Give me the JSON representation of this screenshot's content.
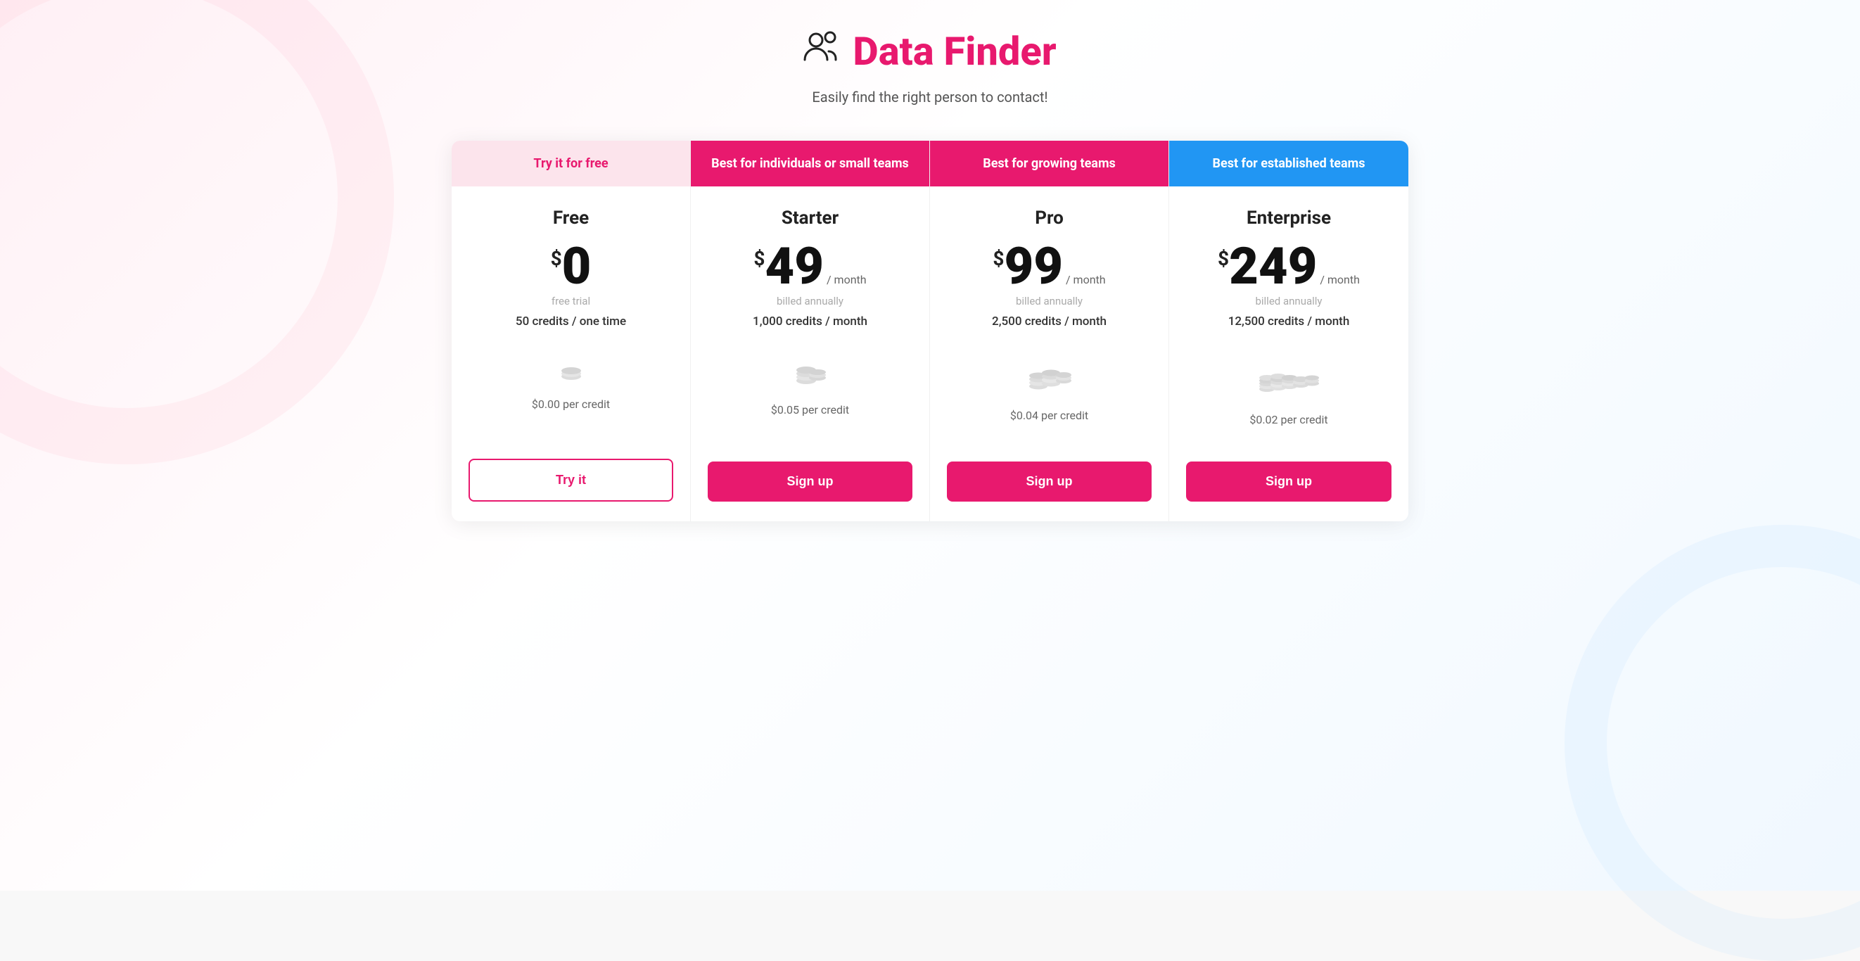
{
  "header": {
    "logo_icon": "👥",
    "title": "Data Finder",
    "subtitle": "Easily find the right person to contact!"
  },
  "plans": [
    {
      "id": "free",
      "header_label": "Try it for free",
      "header_style": "free",
      "name": "Free",
      "price": "0",
      "period": "",
      "billing": "free trial",
      "credits": "50 credits / one time",
      "per_credit": "$0.00 per credit",
      "coin_size": "small",
      "button_label": "Try it",
      "button_style": "btn-free"
    },
    {
      "id": "starter",
      "header_label": "Best for individuals or small teams",
      "header_style": "starter",
      "name": "Starter",
      "price": "49",
      "period": "/ month",
      "billing": "billed annually",
      "credits": "1,000 credits / month",
      "per_credit": "$0.05 per credit",
      "coin_size": "medium",
      "button_label": "Sign up",
      "button_style": "btn-pink"
    },
    {
      "id": "pro",
      "header_label": "Best for growing teams",
      "header_style": "pro",
      "name": "Pro",
      "price": "99",
      "period": "/ month",
      "billing": "billed annually",
      "credits": "2,500 credits / month",
      "per_credit": "$0.04 per credit",
      "coin_size": "large",
      "button_label": "Sign up",
      "button_style": "btn-pink"
    },
    {
      "id": "enterprise",
      "header_label": "Best for established teams",
      "header_style": "enterprise",
      "name": "Enterprise",
      "price": "249",
      "period": "/ month",
      "billing": "billed annually",
      "credits": "12,500 credits / month",
      "per_credit": "$0.02 per credit",
      "coin_size": "xlarge",
      "button_label": "Sign up",
      "button_style": "btn-blue"
    }
  ]
}
